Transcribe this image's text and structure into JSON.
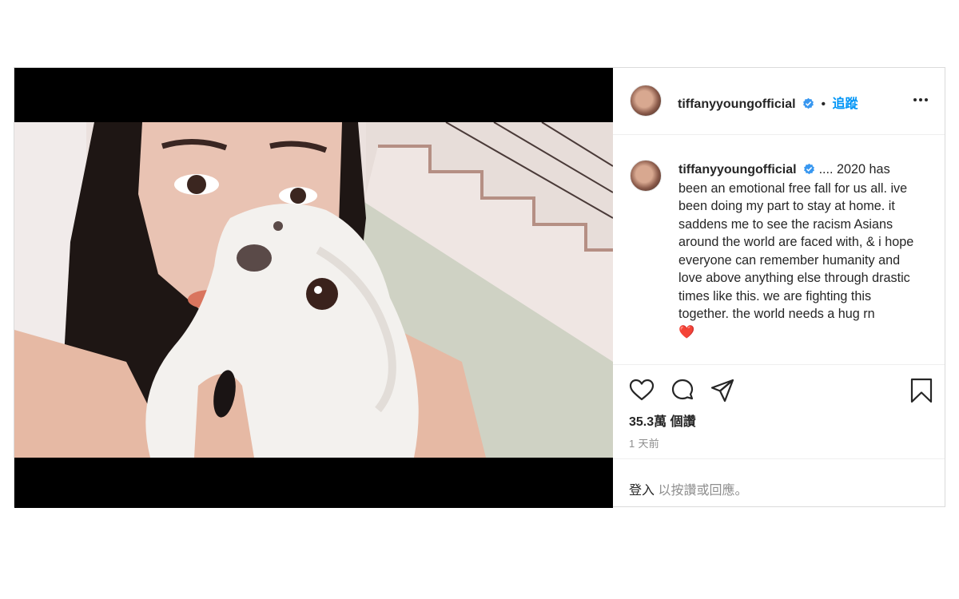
{
  "post": {
    "username": "tiffanyyoungofficial",
    "follow_label": "追蹤",
    "separator": "•",
    "caption": ".... 2020 has been an emotional free fall for us all. ive been doing my part to stay at home. it saddens me to see the racism Asians around the world are faced with, & i hope everyone can remember humanity and love above anything else through drastic times like this. we are fighting this together. the world needs a hug rn",
    "caption_emoji": "❤️",
    "likes": "35.3萬 個讚",
    "timestamp": "1 天前",
    "login_link": "登入",
    "login_rest": " 以按讚或回應。"
  },
  "icons": {
    "verified": "verified-badge-icon",
    "more": "more-options-icon",
    "like": "heart-icon",
    "comment": "comment-bubble-icon",
    "share": "paper-plane-icon",
    "save": "bookmark-icon"
  },
  "colors": {
    "accent": "#0095f6",
    "text": "#262626",
    "muted": "#8e8e8e",
    "border": "#dbdbdb",
    "heart_emoji": "#e0245e"
  }
}
